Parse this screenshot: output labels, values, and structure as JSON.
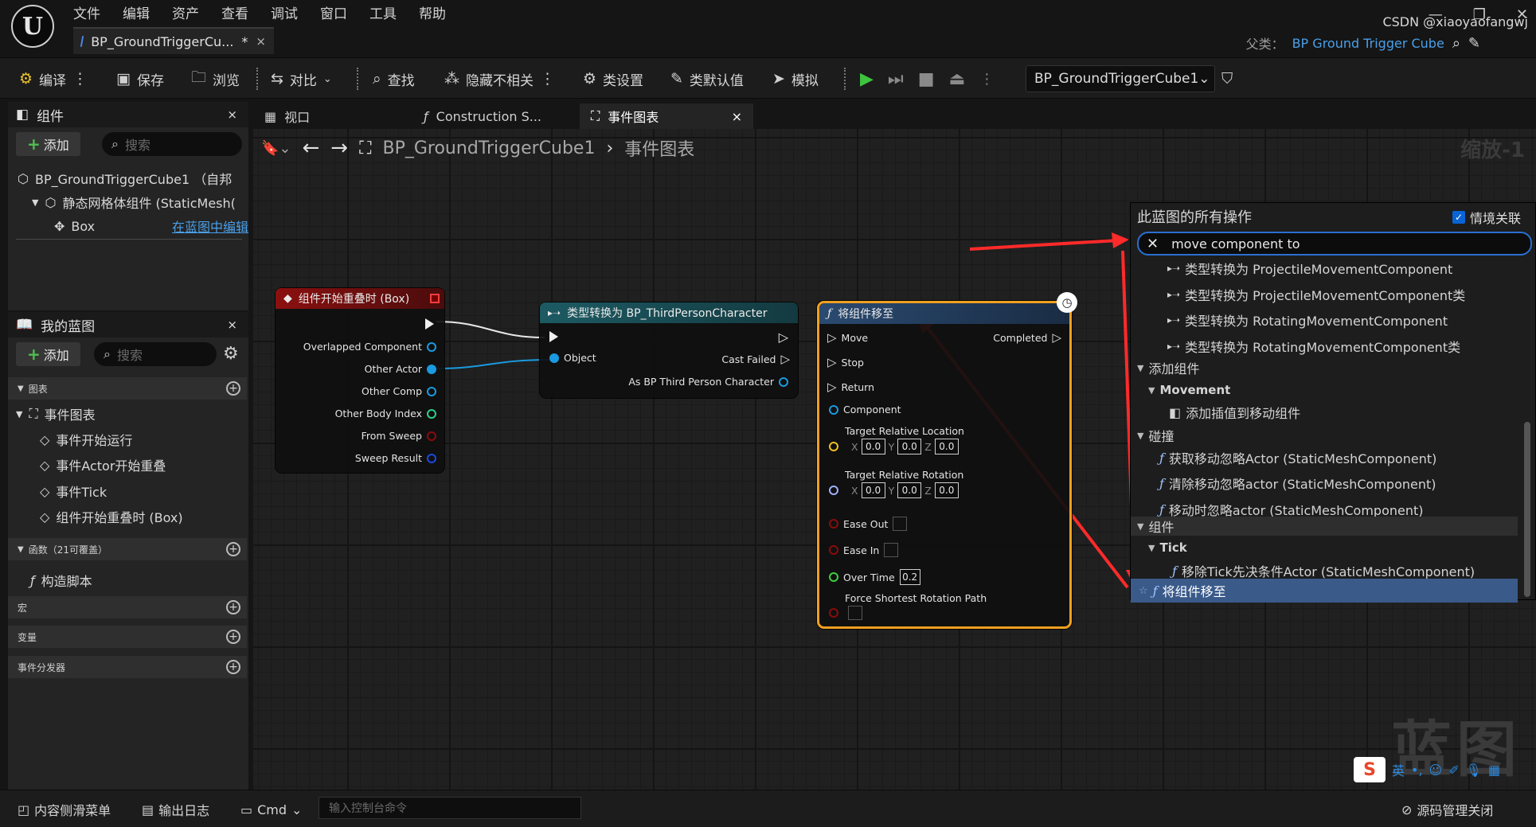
{
  "menu": [
    "文件",
    "编辑",
    "资产",
    "查看",
    "调试",
    "窗口",
    "工具",
    "帮助"
  ],
  "doc_tab": {
    "title": "BP_GroundTriggerCu...",
    "modified": "*",
    "close": "×"
  },
  "window_controls": [
    "—",
    "❐",
    "✕"
  ],
  "parent": {
    "label": "父类：",
    "value": "BP Ground Trigger Cube"
  },
  "toolbar": {
    "compile": "编译",
    "save": "保存",
    "browse": "浏览",
    "diff": "对比",
    "find": "查找",
    "hide_unrelated": "隐藏不相关",
    "class_settings": "类设置",
    "class_defaults": "类默认值",
    "simulate": "模拟",
    "debug_object": "BP_GroundTriggerCube1"
  },
  "components_panel": {
    "tab": "组件",
    "add": "添加",
    "search_placeholder": "搜索",
    "root": "BP_GroundTriggerCube1 （自邦",
    "mesh": "静态网格体组件 (StaticMesh(",
    "box": "Box",
    "edit_link": "在蓝图中编辑"
  },
  "my_blueprint": {
    "tab": "我的蓝图",
    "add": "添加",
    "search_placeholder": "搜索",
    "graphs_header": "图表",
    "event_graph": "事件图表",
    "events": [
      "事件开始运行",
      "事件Actor开始重叠",
      "事件Tick",
      "组件开始重叠时 (Box)"
    ],
    "functions_header": "函数（21可覆盖）",
    "construction_script": "构造脚本",
    "macros_header": "宏",
    "variables_header": "变量",
    "dispatchers_header": "事件分发器"
  },
  "graph_tabs": [
    "视口",
    "Construction S...",
    "事件图表"
  ],
  "breadcrumb": {
    "blueprint": "BP_GroundTriggerCube1",
    "graph": "事件图表"
  },
  "zoom": "缩放-1",
  "watermark": "蓝图",
  "node_overlap": {
    "title": "组件开始重叠时 (Box)",
    "pins": [
      "Overlapped Component",
      "Other Actor",
      "Other Comp",
      "Other Body Index",
      "From Sweep",
      "Sweep Result"
    ]
  },
  "node_cast": {
    "title": "类型转换为 BP_ThirdPersonCharacter",
    "object": "Object",
    "cast_failed": "Cast Failed",
    "as_output": "As BP Third Person Character"
  },
  "node_move": {
    "title": "将组件移至",
    "move": "Move",
    "stop": "Stop",
    "return": "Return",
    "completed": "Completed",
    "component": "Component",
    "target_location": "Target Relative Location",
    "target_rotation": "Target Relative Rotation",
    "axis_labels": [
      "X",
      "Y",
      "Z"
    ],
    "location_values": [
      "0.0",
      "0.0",
      "0.0"
    ],
    "rotation_values": [
      "0.0",
      "0.0",
      "0.0"
    ],
    "ease_out": "Ease Out",
    "ease_in": "Ease In",
    "over_time": "Over Time",
    "over_time_value": "0.2",
    "force_shortest": "Force Shortest Rotation Path"
  },
  "action_menu": {
    "title": "此蓝图的所有操作",
    "context_sensitive": "情境关联",
    "search_value": "move component to",
    "items": [
      {
        "text": "类型转换为 ProjectileMovementComponent",
        "kind": "cast"
      },
      {
        "text": "类型转换为 ProjectileMovementComponent类",
        "kind": "cast"
      },
      {
        "text": "类型转换为 RotatingMovementComponent",
        "kind": "cast"
      },
      {
        "text": "类型转换为 RotatingMovementComponent类",
        "kind": "cast"
      },
      {
        "text": "添加组件",
        "kind": "category"
      },
      {
        "text": "Movement",
        "kind": "subcategory"
      },
      {
        "text": "添加插值到移动组件",
        "kind": "component"
      },
      {
        "text": "碰撞",
        "kind": "category"
      },
      {
        "text": "获取移动忽略Actor (StaticMeshComponent)",
        "kind": "function"
      },
      {
        "text": "清除移动忽略actor (StaticMeshComponent)",
        "kind": "function"
      },
      {
        "text": "移动时忽略actor (StaticMeshComponent)",
        "kind": "function"
      },
      {
        "text": "组件",
        "kind": "category"
      },
      {
        "text": "Tick",
        "kind": "subcategory"
      },
      {
        "text": "移除Tick先决条件Actor (StaticMeshComponent)",
        "kind": "function"
      },
      {
        "text": "将组件移至",
        "kind": "function-selected"
      }
    ]
  },
  "bottom_bar": {
    "content_drawer": "内容侧滑菜单",
    "output_log": "输出日志",
    "cmd": "Cmd",
    "cmd_placeholder": "输入控制台命令",
    "source_control": "源码管理关闭"
  },
  "csdn": "CSDN @xiaoyaofangwj",
  "colors": {
    "accent_blue": "#2a6fd0",
    "selected_node_border": "#f0a020",
    "event_header": "#7a1010",
    "cast_header": "#1d5a63",
    "function_header": "#2a4a70"
  }
}
